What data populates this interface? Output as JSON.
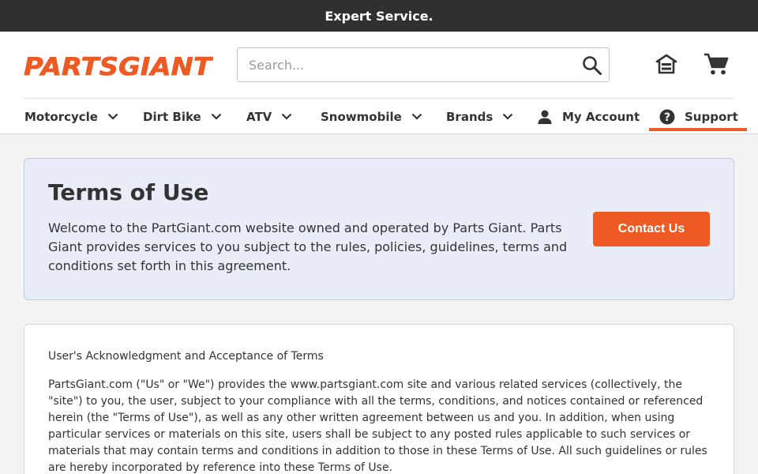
{
  "promo": {
    "text": "Expert Service."
  },
  "brand": {
    "logo_text": "PARTSGIANT",
    "accent": "#ee5a24"
  },
  "search": {
    "placeholder": "Search...",
    "value": ""
  },
  "header_icons": {
    "store": "store-icon",
    "cart": "cart-icon"
  },
  "nav": {
    "items": [
      {
        "label": "Motorcycle"
      },
      {
        "label": "Dirt Bike"
      },
      {
        "label": "ATV"
      },
      {
        "label": "Snowmobile"
      },
      {
        "label": "Brands"
      },
      {
        "label": "My Account"
      },
      {
        "label": "Support"
      }
    ],
    "active": "Support"
  },
  "hero": {
    "title": "Terms of Use",
    "text": "Welcome to the PartGiant.com website owned and operated by Parts Giant. Parts Giant provides services to you subject to the rules, policies, guidelines, terms and conditions set forth in this agreement.",
    "button": "Contact Us"
  },
  "content": {
    "section_title": "User's Acknowledgment and Acceptance of Terms",
    "paragraph": "PartsGiant.com (\"Us\" or \"We\") provides the www.partsgiant.com site and various related services (collectively, the \"site\") to you, the user, subject to your compliance with all the terms, conditions, and notices contained or referenced herein (the \"Terms of Use\"), as well as any other written agreement between us and you. In addition, when using particular services or materials on this site, users shall be subject to any posted rules applicable to such services or materials that may contain terms and conditions in addition to those in these Terms of Use. All such guidelines or rules are hereby incorporated by reference into these Terms of Use."
  }
}
